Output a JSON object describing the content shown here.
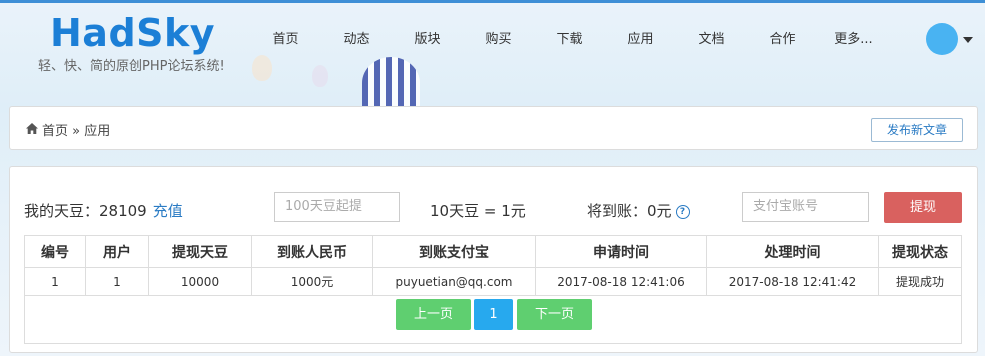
{
  "logo": {
    "title": "HadSky",
    "subtitle": "轻、快、简的原创PHP论坛系统!"
  },
  "nav": [
    "首页",
    "动态",
    "版块",
    "购买",
    "下载",
    "应用",
    "文档",
    "合作",
    "更多..."
  ],
  "breadcrumb": {
    "home": "首页",
    "separator": "»",
    "current": "应用"
  },
  "publish_button": "发布新文章",
  "account": {
    "beans_label": "我的天豆：28109",
    "recharge": "充值",
    "min_placeholder": "100天豆起提",
    "rate": "10天豆 = 1元",
    "arrive": "将到账：0元",
    "alipay_placeholder": "支付宝账号",
    "withdraw_button": "提现"
  },
  "table": {
    "headers": [
      "编号",
      "用户",
      "提现天豆",
      "到账人民币",
      "到账支付宝",
      "申请时间",
      "处理时间",
      "提现状态"
    ],
    "rows": [
      [
        "1",
        "1",
        "10000",
        "1000元",
        "puyuetian@qq.com",
        "2017-08-18 12:41:06",
        "2017-08-18 12:41:42",
        "提现成功"
      ]
    ]
  },
  "pager": {
    "prev": "上一页",
    "current": "1",
    "next": "下一页"
  },
  "colors": {
    "accent": "#1c7fd6",
    "withdraw": "#d9615f",
    "pager_green": "#5fcf70",
    "pager_blue": "#27a9ee",
    "success": "#5cb85c"
  }
}
